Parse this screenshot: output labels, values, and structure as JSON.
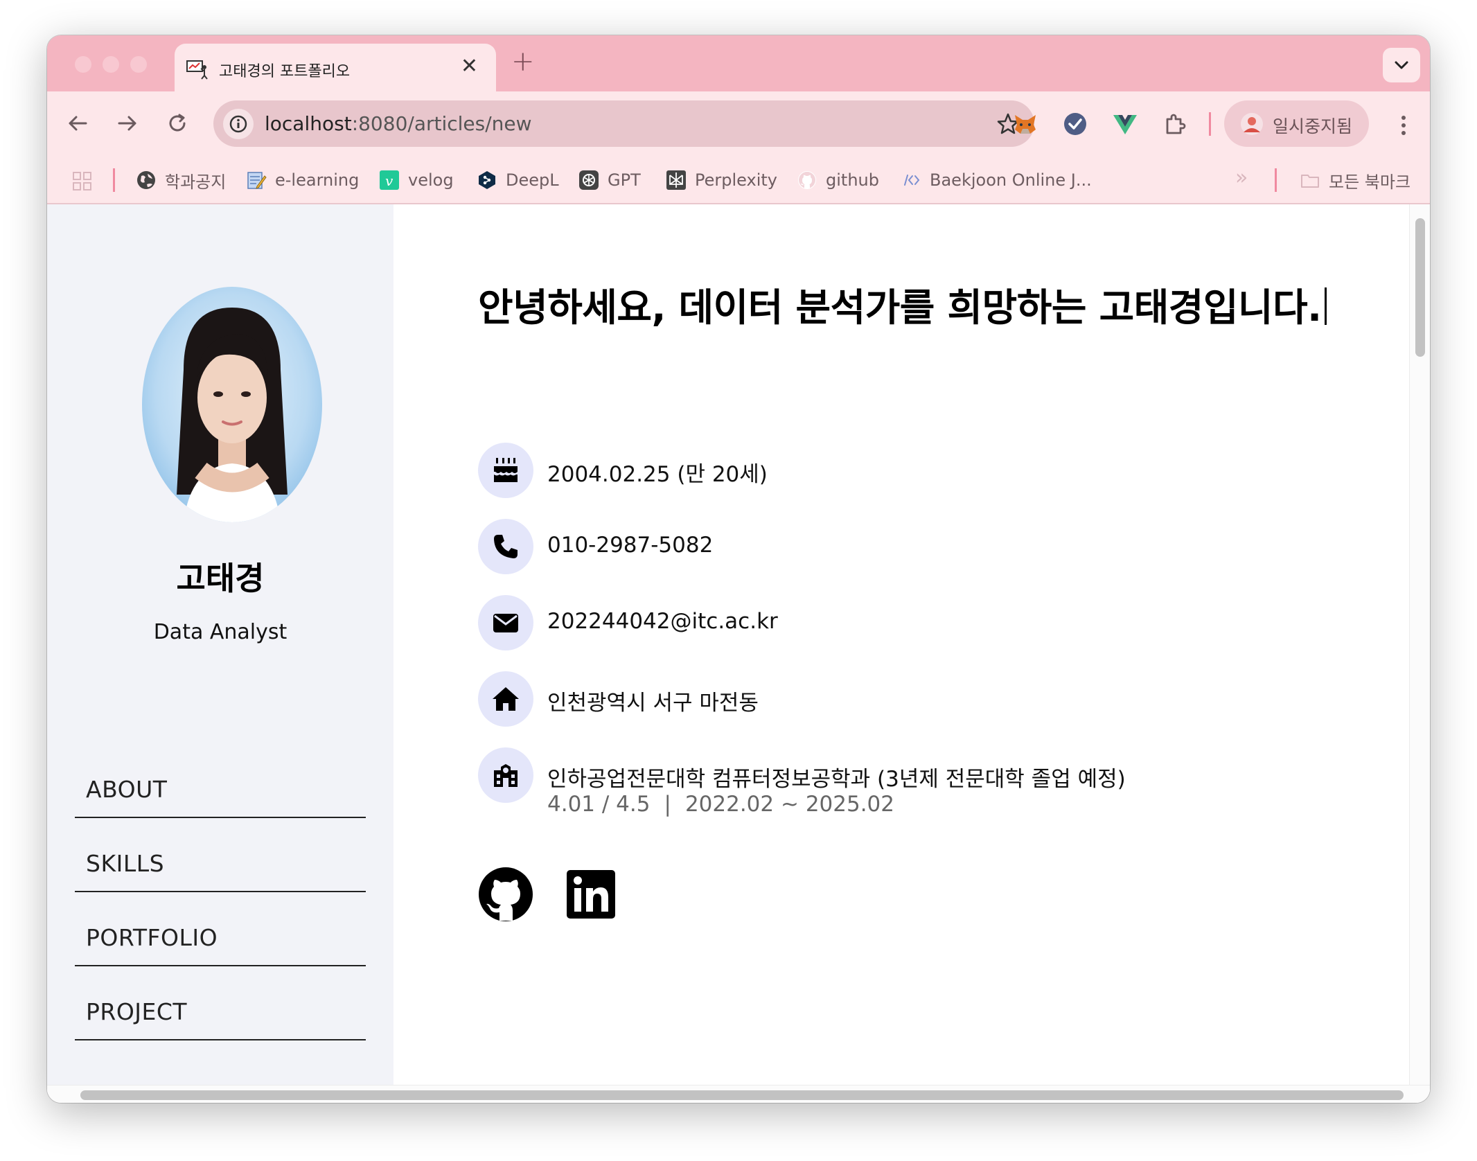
{
  "browser": {
    "tab_title": "고태경의 포트폴리오",
    "tab_close": "✕",
    "new_tab": "+",
    "url_host": "localhost",
    "url_rest": ":8080/articles/new",
    "profile_label": "일시중지됨",
    "bookmarks": [
      {
        "label": "학과공지",
        "icon": "globe-icon"
      },
      {
        "label": "e-learning",
        "icon": "notepad-icon"
      },
      {
        "label": "velog",
        "icon": "velog-icon"
      },
      {
        "label": "DeepL",
        "icon": "deepl-icon"
      },
      {
        "label": "GPT",
        "icon": "chatgpt-icon"
      },
      {
        "label": "Perplexity",
        "icon": "perplexity-icon"
      },
      {
        "label": "github",
        "icon": "github-icon"
      },
      {
        "label": "Baekjoon Online J...",
        "icon": "code-icon"
      }
    ],
    "all_bookmarks": "모든 북마크",
    "overflow": "»"
  },
  "sidebar": {
    "name": "고태경",
    "role": "Data Analyst",
    "menu": [
      "ABOUT",
      "SKILLS",
      "PORTFOLIO",
      "PROJECT"
    ]
  },
  "main": {
    "headline": "안녕하세요, 데이터 분석가를 희망하는 고태경입니다.",
    "info": [
      {
        "icon": "birthday-cake-icon",
        "text": "2004.02.25 (만 20세)"
      },
      {
        "icon": "phone-icon",
        "text": "010-2987-5082"
      },
      {
        "icon": "envelope-icon",
        "text": "202244042@itc.ac.kr"
      },
      {
        "icon": "home-icon",
        "text": "인천광역시 서구 마전동"
      },
      {
        "icon": "school-icon",
        "text": "인하공업전문대학 컴퓨터정보공학과 (3년제 전문대학 졸업 예정)"
      }
    ],
    "gpa": "4.01 / 4.5",
    "gpa_separator": "|",
    "period": "2022.02 ~ 2025.02"
  },
  "colors": {
    "tab_strip": "#f4b5c1",
    "toolbar": "#fde7ea",
    "sidebar_bg": "#f2f3f8",
    "icon_circle": "#e4e6fa"
  }
}
